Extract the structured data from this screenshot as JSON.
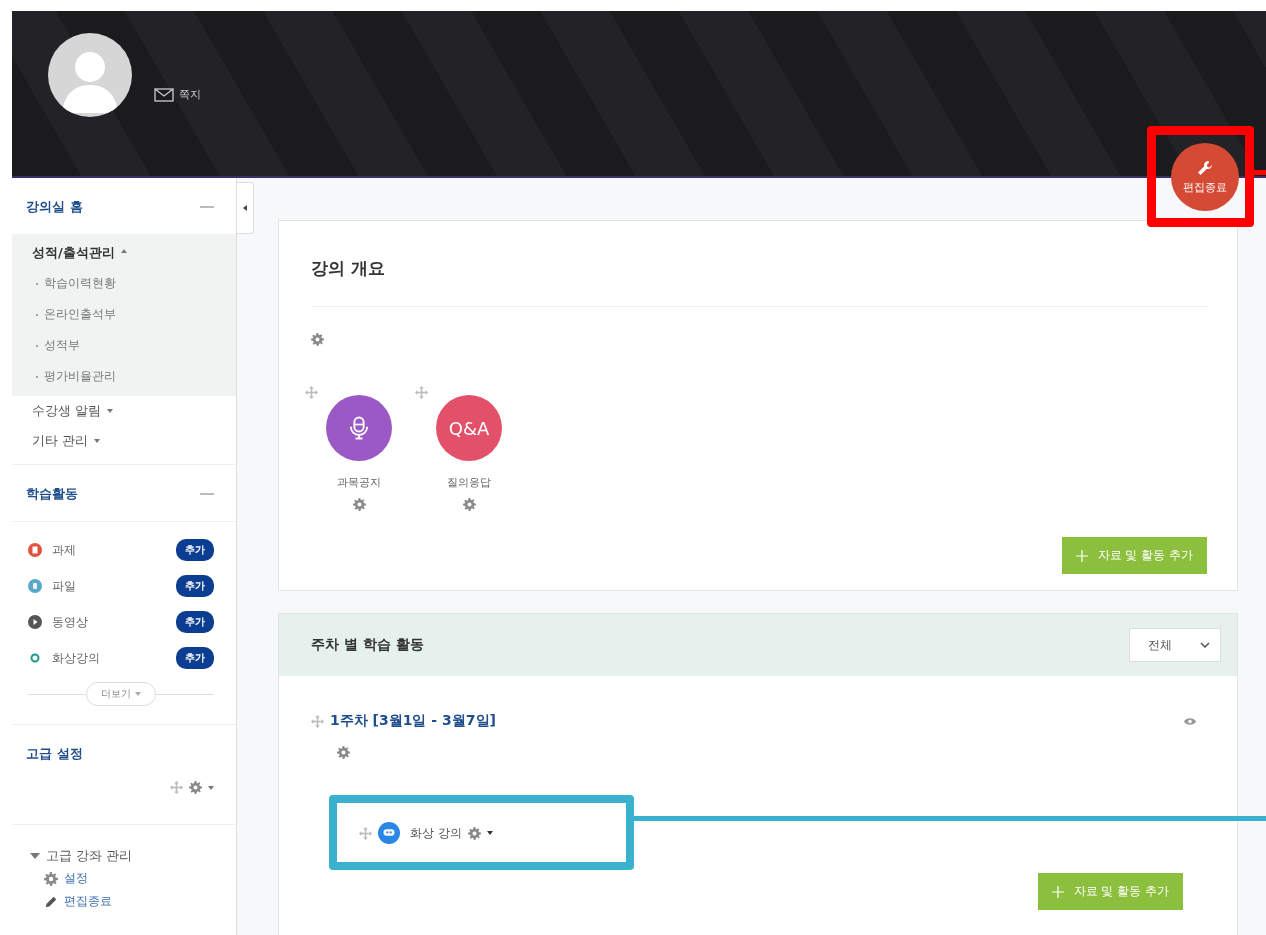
{
  "header": {
    "message_link": "쪽지",
    "edit_button": "편집종료"
  },
  "sidebar": {
    "course_home": {
      "title": "강의실 홈",
      "menu": [
        {
          "label": "성적/출석관리",
          "expanded": true,
          "children": [
            "학습이력현황",
            "온라인출석부",
            "성적부",
            "평가비율관리"
          ]
        },
        {
          "label": "수강생 알림",
          "expanded": false
        },
        {
          "label": "기타 관리",
          "expanded": false
        }
      ]
    },
    "activities": {
      "title": "학습활동",
      "items": [
        {
          "label": "과제",
          "kind": "assignment",
          "color": "#e0533f",
          "button": "추가"
        },
        {
          "label": "파일",
          "kind": "file",
          "color": "#5aa8c8",
          "button": "추가"
        },
        {
          "label": "동영상",
          "kind": "video",
          "color": "#555555",
          "button": "추가"
        },
        {
          "label": "화상강의",
          "kind": "conference",
          "color": "#1a9a8a",
          "button": "추가"
        }
      ],
      "more": "더보기"
    },
    "advanced": {
      "title": "고급 설정",
      "tree": [
        {
          "label": "고급 강좌 관리",
          "expanded": true,
          "children": [
            {
              "label": "설정",
              "kind": "gear"
            },
            {
              "label": "편집종료",
              "kind": "pencil"
            }
          ]
        }
      ]
    }
  },
  "overview": {
    "title": "강의 개요",
    "modules": [
      {
        "label": "과목공지",
        "kind": "mic",
        "color": "#9b59c6"
      },
      {
        "label": "질의응답",
        "kind": "qa",
        "icon_text": "Q&A",
        "color": "#e2506a"
      }
    ],
    "add_button": "자료 및 활동 추가"
  },
  "weekly": {
    "title": "주차 별 학습 활동",
    "filter": "전체",
    "weeks": [
      {
        "title": "1주차 [3월1일 - 3월7일]",
        "visible": true,
        "activities": [
          {
            "label": "화상 강의"
          }
        ],
        "add_button": "자료 및 활동 추가"
      }
    ]
  }
}
